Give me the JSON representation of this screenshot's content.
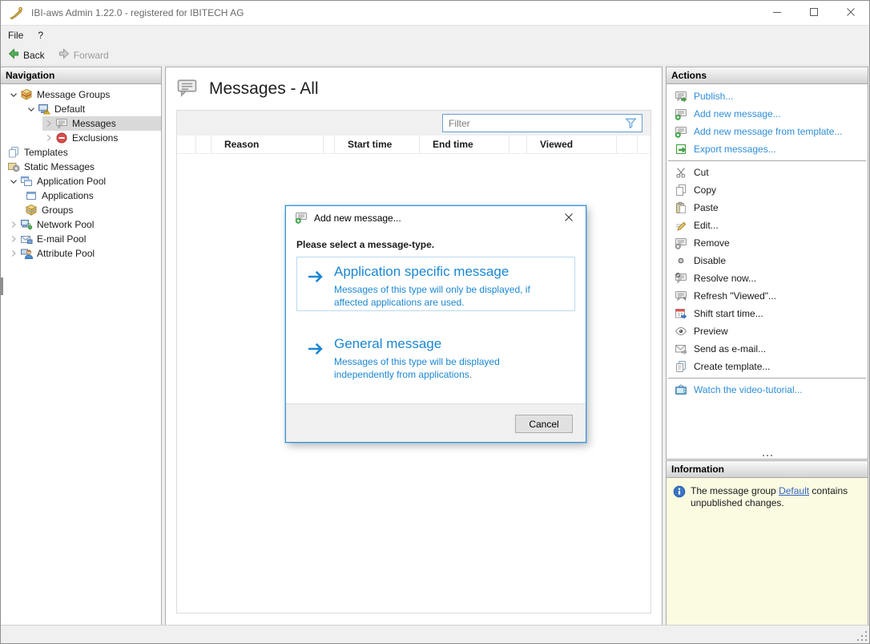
{
  "window": {
    "title": "IBI-aws Admin 1.22.0 - registered for IBITECH AG",
    "controls": [
      {
        "name": "minimize"
      },
      {
        "name": "maximize"
      },
      {
        "name": "close"
      }
    ]
  },
  "menu": {
    "items": [
      {
        "label": "File"
      },
      {
        "label": "?"
      }
    ]
  },
  "toolbar": {
    "back_label": "Back",
    "forward_label": "Forward"
  },
  "navigation": {
    "header": "Navigation",
    "tree": [
      {
        "label": "Message Groups",
        "icon": "message-groups-icon",
        "level": 0,
        "chevron": "expanded",
        "selected": false
      },
      {
        "label": "Default",
        "icon": "message-group-icon",
        "level": 1,
        "chevron": "expanded",
        "selected": false
      },
      {
        "label": "Messages",
        "icon": "messages-icon",
        "level": 2,
        "chevron": "collapsed",
        "selected": true
      },
      {
        "label": "Exclusions",
        "icon": "exclusions-icon",
        "level": 2,
        "chevron": "collapsed",
        "selected": false
      },
      {
        "label": "Templates",
        "icon": "templates-icon",
        "level": 0,
        "chevron": "none",
        "selected": false
      },
      {
        "label": "Static Messages",
        "icon": "static-messages-icon",
        "level": 0,
        "chevron": "none",
        "selected": false
      },
      {
        "label": "Application Pool",
        "icon": "application-pool-icon",
        "level": 0,
        "chevron": "expanded",
        "selected": false
      },
      {
        "label": "Applications",
        "icon": "applications-icon",
        "level": 1,
        "chevron": "none",
        "selected": false
      },
      {
        "label": "Groups",
        "icon": "groups-icon",
        "level": 1,
        "chevron": "none",
        "selected": false
      },
      {
        "label": "Network Pool",
        "icon": "network-pool-icon",
        "level": 0,
        "chevron": "collapsed",
        "selected": false
      },
      {
        "label": "E-mail Pool",
        "icon": "email-pool-icon",
        "level": 0,
        "chevron": "collapsed",
        "selected": false
      },
      {
        "label": "Attribute Pool",
        "icon": "attribute-pool-icon",
        "level": 0,
        "chevron": "collapsed",
        "selected": false
      }
    ]
  },
  "main": {
    "title": "Messages - All",
    "filter_placeholder": "Filter",
    "table": {
      "columns": [
        "",
        "",
        "Reason",
        "",
        "Start time",
        "End time",
        "",
        "Viewed",
        ""
      ],
      "rows": []
    }
  },
  "actions": {
    "header": "Actions",
    "groups": [
      {
        "items": [
          {
            "label": "Publish...",
            "icon": "publish-icon",
            "link": true
          },
          {
            "label": "Add new message...",
            "icon": "add-message-icon",
            "link": true
          },
          {
            "label": "Add new message from template...",
            "icon": "add-message-icon",
            "link": true
          },
          {
            "label": "Export messages...",
            "icon": "export-icon",
            "link": true
          }
        ]
      },
      {
        "items": [
          {
            "label": "Cut",
            "icon": "cut-icon",
            "link": false
          },
          {
            "label": "Copy",
            "icon": "copy-icon",
            "link": false
          },
          {
            "label": "Paste",
            "icon": "paste-icon",
            "link": false
          },
          {
            "label": "Edit...",
            "icon": "edit-icon",
            "link": false
          },
          {
            "label": "Remove",
            "icon": "remove-icon",
            "link": false
          },
          {
            "label": "Disable",
            "icon": "disable-icon",
            "link": false
          },
          {
            "label": "Resolve now...",
            "icon": "resolve-icon",
            "link": false
          },
          {
            "label": "Refresh \"Viewed\"...",
            "icon": "refresh-viewed-icon",
            "link": false
          },
          {
            "label": "Shift start time...",
            "icon": "shift-time-icon",
            "link": false
          },
          {
            "label": "Preview",
            "icon": "preview-icon",
            "link": false
          },
          {
            "label": "Send as e-mail...",
            "icon": "send-email-icon",
            "link": false
          },
          {
            "label": "Create template...",
            "icon": "create-template-icon",
            "link": false
          }
        ]
      },
      {
        "items": [
          {
            "label": "Watch the video-tutorial...",
            "icon": "video-tutorial-icon",
            "link": true
          }
        ]
      }
    ]
  },
  "information": {
    "header": "Information",
    "text_before": "The message group ",
    "link_text": "Default",
    "text_after": " contains unpublished changes."
  },
  "dialog": {
    "title": "Add new message...",
    "prompt": "Please select a message-type.",
    "options": [
      {
        "title": "Application specific message",
        "description": "Messages of this type will only be displayed, if affected applications are used.",
        "highlighted": true
      },
      {
        "title": "General message",
        "description": "Messages of this type will be displayed independently from applications.",
        "highlighted": false
      }
    ],
    "cancel_label": "Cancel"
  },
  "colors": {
    "accent_blue": "#1b87d3",
    "action_link_blue": "#2e8ed8",
    "info_link_blue": "#3565c0",
    "dialog_border_blue": "#3696dd",
    "info_panel_yellow": "#fbfbe1",
    "selection_gray": "#d9d9d9",
    "panel_gray": "#f0f0f0"
  }
}
